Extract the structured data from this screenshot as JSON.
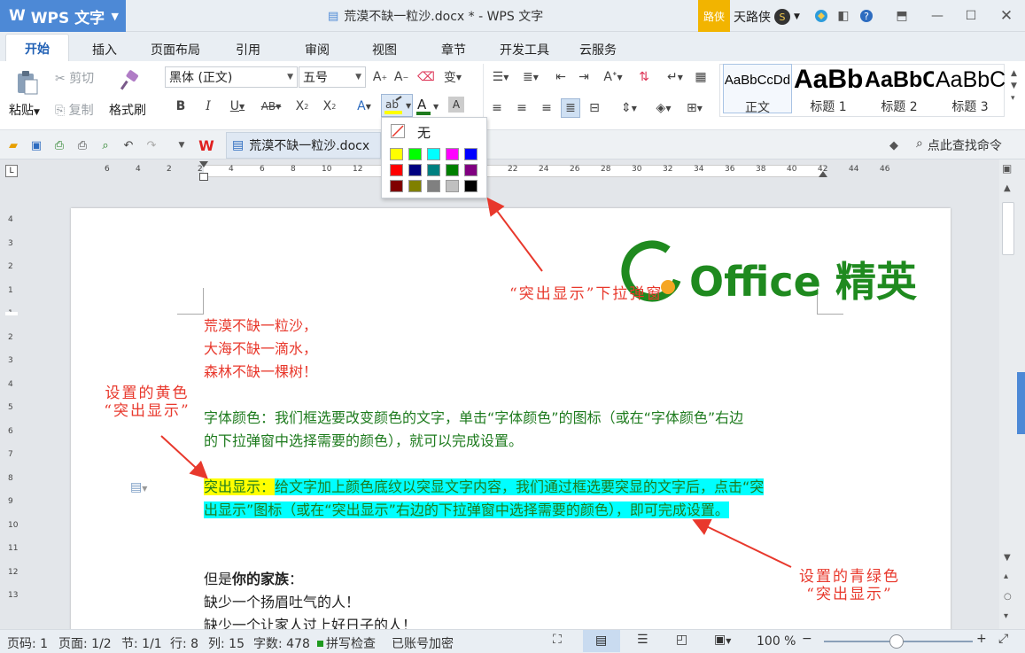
{
  "titlebar": {
    "app_label": "WPS 文字",
    "doc_title": "荒漠不缺一粒沙.docx * - WPS 文字",
    "user_badge": "路侠",
    "user_name": "天路侠"
  },
  "menu": {
    "tabs": [
      "开始",
      "插入",
      "页面布局",
      "引用",
      "审阅",
      "视图",
      "章节",
      "开发工具",
      "云服务"
    ]
  },
  "ribbon": {
    "paste": "粘贴",
    "cut": "剪切",
    "copy": "复制",
    "format_painter": "格式刷",
    "font_name": "黑体 (正文)",
    "font_size": "五号",
    "styles": [
      {
        "preview": "AaBbCcDd",
        "label": "正文"
      },
      {
        "preview": "AaBb",
        "label": "标题 1"
      },
      {
        "preview": "AaBbC",
        "label": "标题 2"
      },
      {
        "preview": "AaBbC",
        "label": "标题 3"
      }
    ]
  },
  "quickbar": {
    "doc_tab": "荒漠不缺一粒沙.docx",
    "search": "点此查找命令"
  },
  "highlight_popup": {
    "none_label": "无",
    "colors": [
      "#ffff00",
      "#00ff00",
      "#00ffff",
      "#ff00ff",
      "#0000ff",
      "#ff0000",
      "#000080",
      "#008080",
      "#008000",
      "#800080",
      "#800000",
      "#808000",
      "#808080",
      "#c0c0c0",
      "#000000"
    ]
  },
  "document": {
    "logo_text": "Office 精英",
    "poem": [
      "荒漠不缺一粒沙，",
      "大海不缺一滴水，",
      "森林不缺一棵树！"
    ],
    "font_color_para": [
      "字体颜色：我们框选要改变颜色的文字，单击“字体颜色”的图标（或在“字体颜色”右边",
      "的下拉弹窗中选择需要的颜色），就可以完成设置。"
    ],
    "highlight_label": "突出显示：",
    "highlight_text_1": "给文字加上颜色底纹以突显文字内容，我们通过框选要突显的文字后，点击“突",
    "highlight_text_2": "出显示”图标（或在“突出显示”右边的下拉弹窗中选择需要的颜色），即可完成设置。",
    "but_prefix": "但是",
    "but_bold": "你的家族",
    "but_suffix": "：",
    "line_1": "缺少一个扬眉吐气的人！",
    "line_2": "缺少一个让家人过上好日子的人！"
  },
  "annotations": {
    "popup_note": "“突出显示”下拉弹窗",
    "yellow_note_1": "设置的黄色",
    "yellow_note_2": "“突出显示”",
    "cyan_note_1": "设置的青绿色",
    "cyan_note_2": "“突出显示”"
  },
  "status": {
    "page": "页码: 1",
    "pages": "页面: 1/2",
    "section": "节: 1/1",
    "row": "行: 8",
    "col": "列: 15",
    "words": "字数: 478",
    "spell": "拼写检查",
    "encrypt": "已账号加密",
    "zoom": "100 %"
  },
  "hruler_labels": [
    "6",
    "4",
    "2",
    "2",
    "4",
    "6",
    "8",
    "10",
    "12",
    "14",
    "16",
    "18",
    "20",
    "22",
    "24",
    "26",
    "28",
    "30",
    "32",
    "34",
    "36",
    "38",
    "40",
    "42",
    "44",
    "46"
  ],
  "vruler_labels": [
    "4",
    "3",
    "2",
    "1",
    "1",
    "2",
    "3",
    "4",
    "5",
    "6",
    "7",
    "8",
    "9",
    "10",
    "11",
    "12",
    "13"
  ]
}
